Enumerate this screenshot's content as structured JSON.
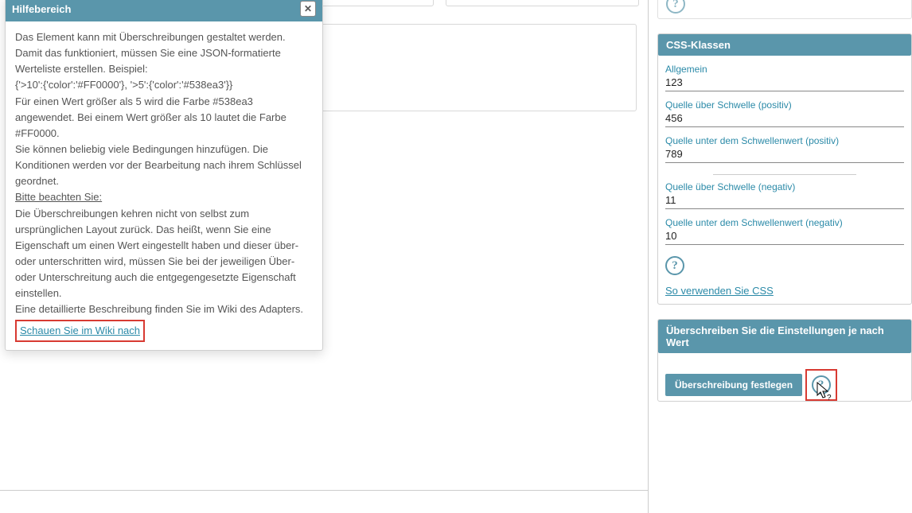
{
  "help": {
    "title": "Hilfebereich",
    "p1": "Das Element kann mit Überschreibungen gestaltet werden. Damit das funktioniert, müssen Sie eine JSON-formatierte Werteliste erstellen. Beispiel:",
    "code": "{'>10':{'color':'#FF0000'}, '>5':{'color':'#538ea3'}}",
    "p2": "Für einen Wert größer als 5 wird die Farbe #538ea3 angewendet. Bei einem Wert größer als 10 lautet die Farbe #FF0000.",
    "p3": "Sie können beliebig viele Bedingungen hinzufügen. Die Konditionen werden vor der Bearbeitung nach ihrem Schlüssel geordnet.",
    "note_label": "Bitte beachten Sie:",
    "p4": "Die Überschreibungen kehren nicht von selbst zum ursprünglichen Layout zurück. Das heißt, wenn Sie eine Eigenschaft um einen Wert eingestellt haben und dieser über- oder unterschritten wird, müssen Sie bei der jeweiligen Über- oder Unterschreitung auch die entgegengesetzte Eigenschaft einstellen.",
    "p5": "Eine detaillierte Beschreibung finden Sie im Wiki des Adapters.",
    "wiki_link": "Schauen Sie im Wiki nach"
  },
  "css_panel": {
    "title": "CSS-Klassen",
    "f1_label": "Allgemein",
    "f1_value": "123",
    "f2_label": "Quelle über Schwelle (positiv)",
    "f2_value": "456",
    "f3_label": "Quelle unter dem Schwellenwert (positiv)",
    "f3_value": "789",
    "f4_label": "Quelle über Schwelle (negativ)",
    "f4_value": "11",
    "f5_label": "Quelle unter dem Schwellenwert (negativ)",
    "f5_value": "10",
    "css_link": "So verwenden Sie CSS"
  },
  "override_panel": {
    "title": "Überschreiben Sie die Einstellungen je nach Wert",
    "button": "Überschreibung festlegen"
  }
}
